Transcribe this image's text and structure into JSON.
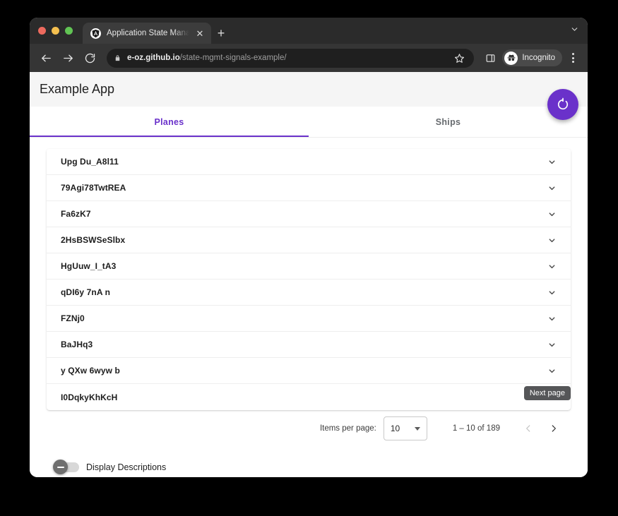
{
  "browser": {
    "tab": {
      "favicon": "angular-a-icon",
      "title": "Application State Management",
      "close_icon": "close-icon"
    },
    "new_tab_label": "+",
    "tabstrip_caret_icon": "chevron-down-icon",
    "toolbar": {
      "back_icon": "back-arrow-icon",
      "forward_icon": "forward-arrow-icon",
      "reload_icon": "reload-icon",
      "lock_icon": "lock-icon",
      "url_host": "e-oz.github.io",
      "url_path": "/state-mgmt-signals-example/",
      "bookmark_icon": "star-icon",
      "sidepanel_icon": "side-panel-icon",
      "incognito_icon": "incognito-icon",
      "incognito_label": "Incognito",
      "menu_icon": "kebab-menu-icon"
    }
  },
  "app": {
    "header": {
      "title": "Example App",
      "fab_icon": "refresh-icon"
    },
    "tabs": [
      {
        "label": "Planes",
        "active": true
      },
      {
        "label": "Ships",
        "active": false
      }
    ],
    "list": {
      "rows": [
        {
          "name": "Upg Du_A8l11"
        },
        {
          "name": "79Agi78TwtREA"
        },
        {
          "name": "Fa6zK7"
        },
        {
          "name": "2HsBSWSeSlbx"
        },
        {
          "name": "HgUuw_I_tA3"
        },
        {
          "name": "qDI6y 7nA n"
        },
        {
          "name": "FZNj0"
        },
        {
          "name": "BaJHq3"
        },
        {
          "name": "y QXw 6wyw b"
        },
        {
          "name": "I0DqkyKhKcH"
        }
      ],
      "expand_icon": "chevron-down-icon"
    },
    "paginator": {
      "items_per_page_label": "Items per page:",
      "items_per_page_value": "10",
      "select_caret_icon": "caret-down-icon",
      "range_label": "1 – 10 of 189",
      "prev_icon": "chevron-left-icon",
      "next_icon": "chevron-right-icon",
      "next_tooltip": "Next page"
    },
    "display_descriptions": {
      "label": "Display Descriptions",
      "checked": false,
      "thumb_icon": "minus-icon"
    },
    "colors": {
      "accent": "#6a31ca",
      "header_bg": "#f5f5f5",
      "tooltip_bg": "#555658"
    }
  }
}
